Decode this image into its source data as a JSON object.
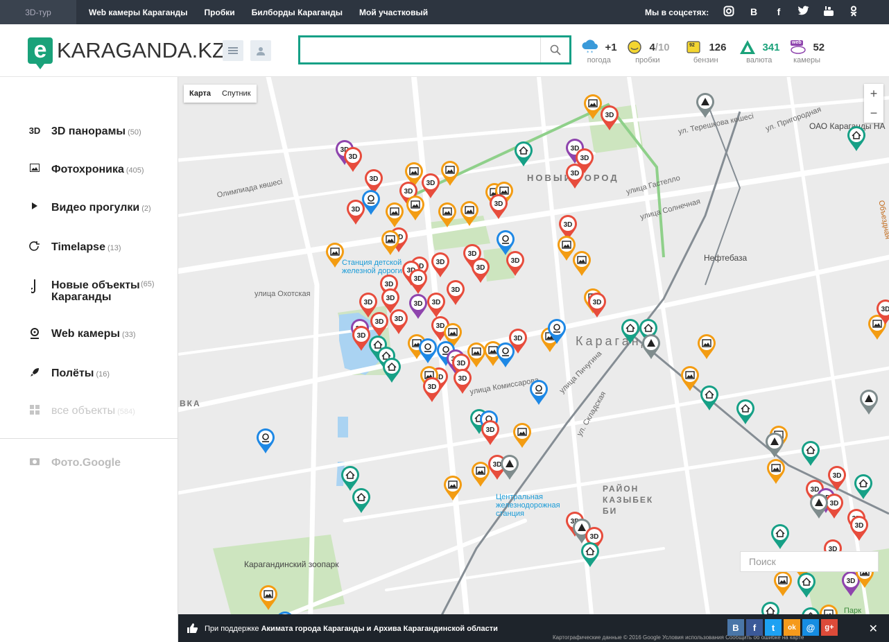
{
  "topbar": {
    "tour": "3D-тур",
    "nav": [
      "Web камеры Караганды",
      "Пробки",
      "Билборды Караганды",
      "Мой участковый"
    ],
    "social_label": "Мы в соцсетях:",
    "social_icons": [
      "instagram-icon",
      "vk-icon",
      "facebook-icon",
      "twitter-icon",
      "youtube-icon",
      "ok-icon"
    ]
  },
  "header": {
    "logo_letter": "e",
    "logo_text": "KARAGANDA.KZ",
    "search_placeholder": "",
    "widgets": [
      {
        "value": "+1",
        "label": "погода",
        "icon": "weather-icon"
      },
      {
        "value": "4",
        "value_suffix": "/10",
        "label": "пробки",
        "icon": "traffic-icon"
      },
      {
        "value": "126",
        "label": "бензин",
        "icon": "fuel-icon",
        "badge": "92"
      },
      {
        "value": "341",
        "label": "валюта",
        "icon": "currency-icon"
      },
      {
        "value": "52",
        "label": "камеры",
        "icon": "webcam-icon",
        "badge": "web"
      }
    ]
  },
  "sidebar": {
    "items": [
      {
        "icon": "3D",
        "label": "3D панорамы",
        "count": "(50)"
      },
      {
        "icon": "photo-icon",
        "label": "Фотохроника",
        "count": "(405)"
      },
      {
        "icon": "play-icon",
        "label": "Видео прогулки",
        "count": "(2)"
      },
      {
        "icon": "timelapse-icon",
        "label": "Timelapse",
        "count": "(13)"
      },
      {
        "icon": "crane-icon",
        "label": "Новые объекты Караганды",
        "count": "(65)"
      },
      {
        "icon": "webcam-icon",
        "label": "Web камеры",
        "count": "(33)"
      },
      {
        "icon": "rocket-icon",
        "label": "Полёты",
        "count": "(16)"
      },
      {
        "icon": "grid-icon",
        "label": "все объекты",
        "count": "(584)"
      }
    ],
    "google_photo": "Фото.Google"
  },
  "map": {
    "type_buttons": [
      "Карта",
      "Спутник"
    ],
    "zoom_in": "+",
    "zoom_out": "−",
    "labels": [
      "НОВЫЙ ГОРОД",
      "Караганда",
      "РАЙОН КАЗЫБЕК БИ",
      "Нефтебаза",
      "ОАО Караганды НА",
      "Станция детской железной дороги",
      "Центральная железнодорожная станция",
      "Карагандинский зоопарк",
      "улица Охотская",
      "улица Комиссарова",
      "ул. Складская",
      "улица Пичугина",
      "улица Гастелло",
      "улица Солнечная",
      "ул. Пригородная",
      "ул. Терешкова көшесі",
      "Олимпиада көшесі",
      "ВКА",
      "Объездная",
      "Парк"
    ],
    "search_placeholder": "Поиск"
  },
  "footer": {
    "prefix": "При поддержке",
    "bold": "Акимата города Караганды и Архива Карагандинской области",
    "attribution": "Картографические данные © 2016 Google   Условия использования   Сообщить об ошибке на карте",
    "share": [
      "В",
      "f",
      "t",
      "ok",
      "@",
      "g+"
    ],
    "close": "✕"
  }
}
